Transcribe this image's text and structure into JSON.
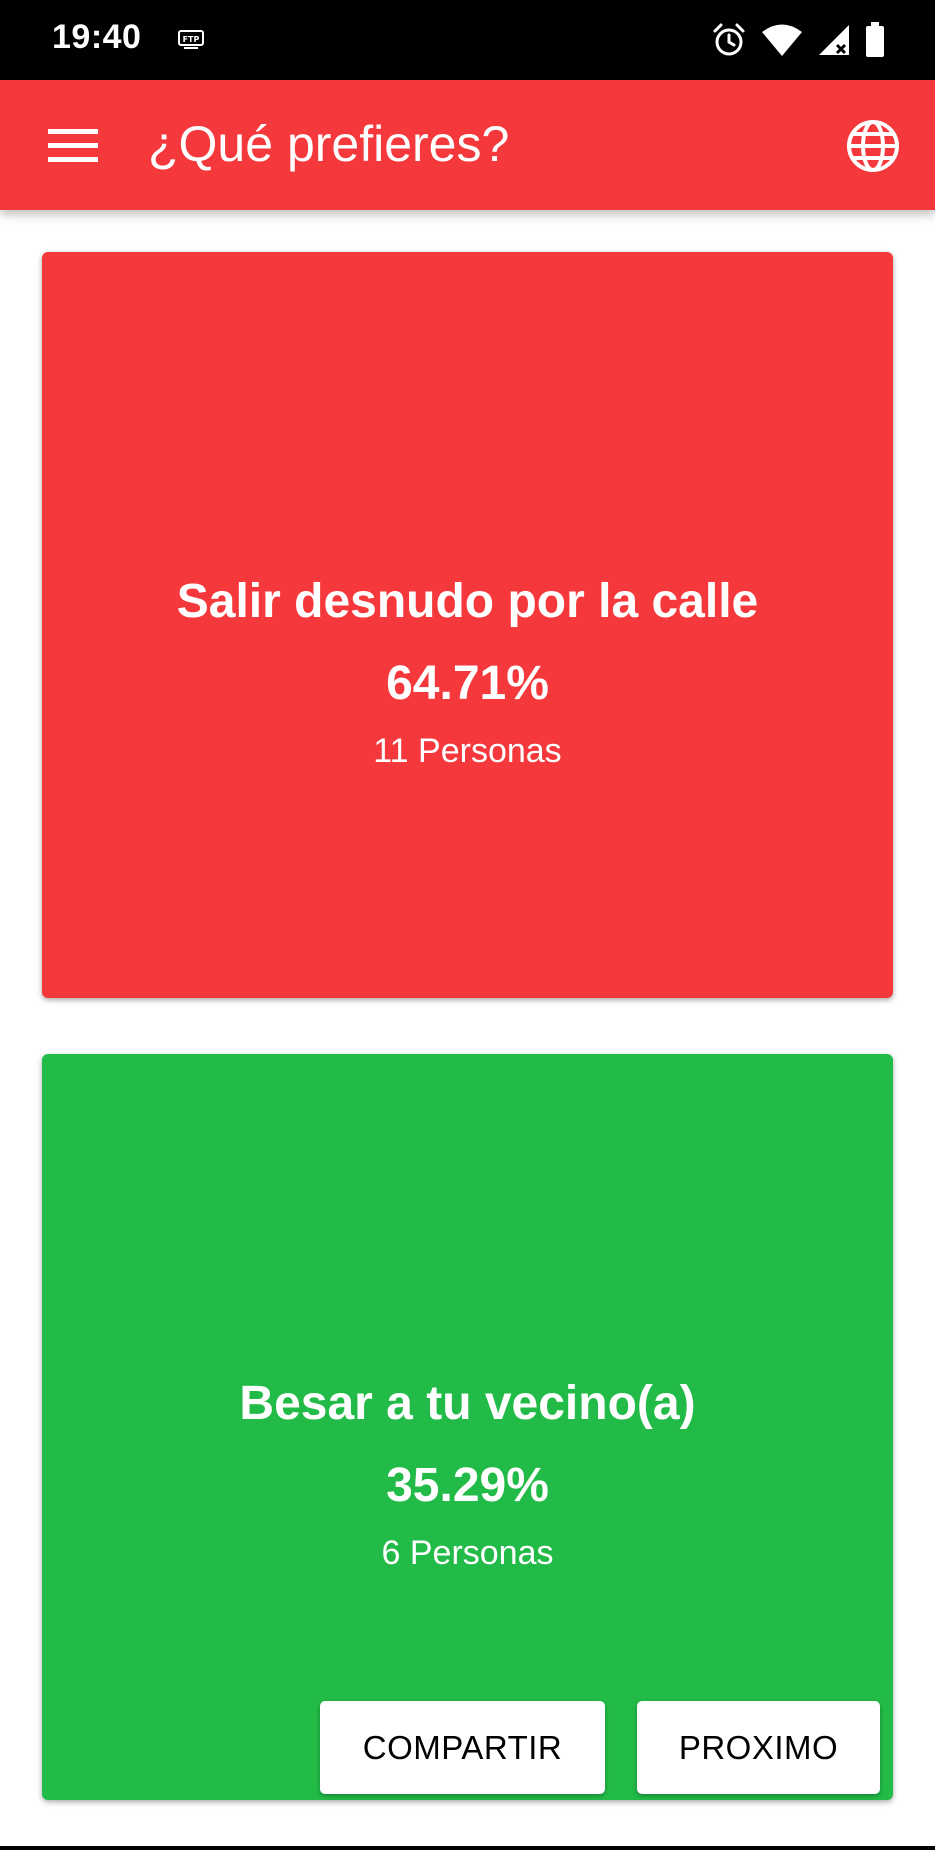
{
  "status_bar": {
    "time": "19:40",
    "icons": [
      "ftp-icon",
      "alarm-icon",
      "wifi-icon",
      "signal-icon",
      "battery-icon"
    ]
  },
  "app_bar": {
    "title": "¿Qué prefieres?",
    "menu_icon": "menu-icon",
    "language_icon": "globe-icon",
    "color": "#f5383b"
  },
  "options": [
    {
      "text": "Salir desnudo por la calle",
      "percent": "64.71%",
      "count": "11 Personas",
      "color": "#f5383b"
    },
    {
      "text": "Besar a tu vecino(a)",
      "percent": "35.29%",
      "count": "6 Personas",
      "color": "#22bb48"
    }
  ],
  "actions": {
    "share_label": "COMPARTIR",
    "next_label": "PROXIMO"
  }
}
